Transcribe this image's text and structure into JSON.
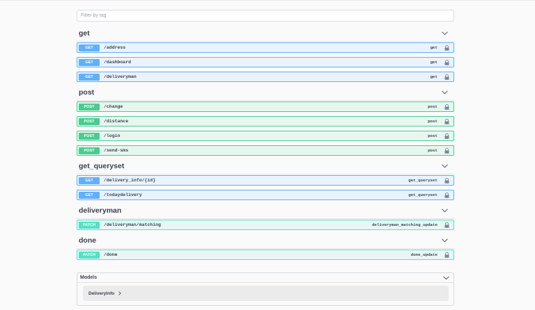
{
  "filter": {
    "placeholder": "Filter by tag"
  },
  "tags": [
    {
      "name": "get",
      "ops": [
        {
          "method": "GET",
          "path": "/address",
          "summary": "get"
        },
        {
          "method": "GET",
          "path": "/dashboard",
          "summary": "get"
        },
        {
          "method": "GET",
          "path": "/deliveryman",
          "summary": "get"
        }
      ]
    },
    {
      "name": "post",
      "ops": [
        {
          "method": "POST",
          "path": "/change",
          "summary": "post"
        },
        {
          "method": "POST",
          "path": "/distance",
          "summary": "post"
        },
        {
          "method": "POST",
          "path": "/login",
          "summary": "post"
        },
        {
          "method": "POST",
          "path": "/send-sms",
          "summary": "post"
        }
      ]
    },
    {
      "name": "get_queryset",
      "ops": [
        {
          "method": "GET",
          "path": "/delivery_info/{id}",
          "summary": "get_queryset"
        },
        {
          "method": "GET",
          "path": "/todaydelivery",
          "summary": "get_queryset"
        }
      ]
    },
    {
      "name": "deliveryman",
      "ops": [
        {
          "method": "PATCH",
          "path": "/deliveryman/matching",
          "summary": "deliveryman_matching_update"
        }
      ]
    },
    {
      "name": "done",
      "ops": [
        {
          "method": "PATCH",
          "path": "/done",
          "summary": "done_update"
        }
      ]
    }
  ],
  "models": {
    "title": "Models",
    "items": [
      "DeliveryInfo"
    ]
  },
  "colors": {
    "get": "#61affe",
    "post": "#49cc90",
    "patch": "#50e3c2"
  },
  "icons": {
    "tag_toggle": "chevron-down-icon",
    "auth": "lock-icon",
    "model_expand": "chevron-right-icon"
  }
}
